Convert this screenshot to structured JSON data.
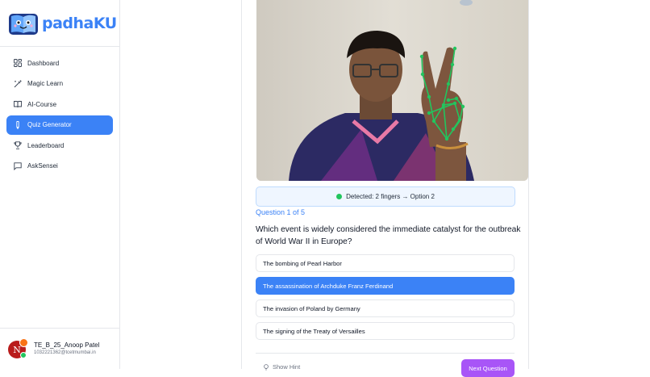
{
  "brand": {
    "name": "padhaKU"
  },
  "sidebar": {
    "items": [
      {
        "label": "Dashboard",
        "icon": "dashboard-grid-icon"
      },
      {
        "label": "Magic Learn",
        "icon": "magic-wand-icon"
      },
      {
        "label": "AI-Course",
        "icon": "open-book-icon"
      },
      {
        "label": "Quiz Generator",
        "icon": "pen-icon",
        "active": true
      },
      {
        "label": "Leaderboard",
        "icon": "trophy-icon"
      },
      {
        "label": "AskSensei",
        "icon": "chat-bubble-icon"
      }
    ]
  },
  "user": {
    "initial": "N",
    "name": "TE_B_25_Anoop Patel",
    "email": "1032221362@tcetmumbai.in"
  },
  "detection": {
    "text": "Detected: 2 fingers → Option 2",
    "status_color": "#22c55e"
  },
  "quiz": {
    "progress": "Question 1 of 5",
    "question": "Which event is widely considered the immediate catalyst for the outbreak of World War II in Europe?",
    "options": [
      "The bombing of Pearl Harbor",
      "The assassination of Archduke Franz Ferdinand",
      "The invasion of Poland by Germany",
      "The signing of the Treaty of Versailles"
    ],
    "selected_index": 1,
    "hint_label": "Show Hint",
    "next_label": "Next Question"
  },
  "colors": {
    "accent": "#3b82f6",
    "next_button": "#a855f7"
  }
}
